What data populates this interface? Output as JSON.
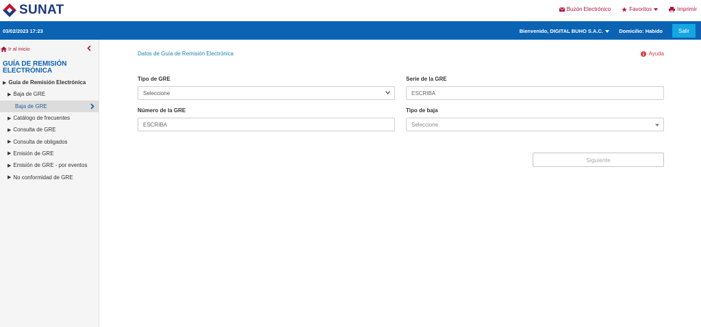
{
  "header": {
    "brand": "SUNAT",
    "links": [
      {
        "label": "Buzón Electrónico",
        "icon": "envelope-icon"
      },
      {
        "label": "Favoritos",
        "icon": "star-icon"
      },
      {
        "label": "Imprimir",
        "icon": "printer-icon"
      }
    ],
    "accent": "#b1153a"
  },
  "bar": {
    "datetime": "03/02/2023 17:23",
    "welcome": "Bienvenido, DIGITAL BUHO S.A.C.",
    "domicilio": "Domicilio: Habido",
    "salir": "Salir",
    "color": "#0b63b4"
  },
  "sidebar": {
    "inicio": "Ir al inicio",
    "title": "GUÍA DE REMISIÓN ELECTRÓNICA",
    "items": [
      {
        "label": "Guía de Remisión Electrónica"
      },
      {
        "label": "Baja de GRE"
      },
      {
        "label": "Baja de GRE"
      },
      {
        "label": "Catálogo de frecuentes"
      },
      {
        "label": "Consulta de GRE"
      },
      {
        "label": "Consulta de obligados"
      },
      {
        "label": "Emisión de GRE"
      },
      {
        "label": "Emisión de GRE - por eventos"
      },
      {
        "label": "No conformidad de GRE"
      }
    ]
  },
  "main": {
    "title": "Datos de Guía de Remisión Electrónica",
    "ayuda": "Ayuda",
    "tipo_gre": {
      "label": "Tipo de GRE",
      "value": "Seleccione"
    },
    "serie_gre": {
      "label": "Serie de la GRE",
      "placeholder": "ESCRIBA"
    },
    "numero_gre": {
      "label": "Número de la GRE",
      "placeholder": "ESCRIBA"
    },
    "tipo_baja": {
      "label": "Tipo de baja",
      "value": "Seleccione"
    },
    "siguiente": "Siguiente"
  }
}
